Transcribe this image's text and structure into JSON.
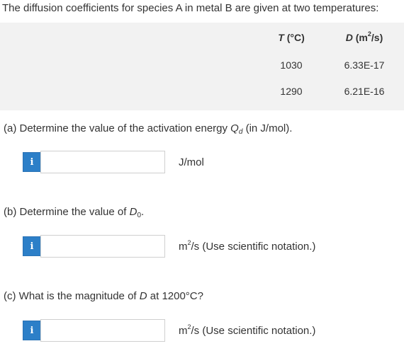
{
  "intro": "The diffusion coefficients for species A in metal B are given at two temperatures:",
  "table": {
    "header_t_italic": "T",
    "header_t_rest": " (°C)",
    "header_d_italic": "D",
    "header_d_unit": " (m",
    "header_d_exp": "2",
    "header_d_close": "/s)",
    "rows": [
      {
        "t": "1030",
        "d": "6.33E-17"
      },
      {
        "t": "1290",
        "d": "6.21E-16"
      }
    ]
  },
  "questions": {
    "a": {
      "prefix": "(a) Determine the value of the activation energy ",
      "sym": "Q",
      "sub": "d",
      "suffix": " (in J/mol)."
    },
    "b": {
      "prefix": "(b) Determine the value of ",
      "sym": "D",
      "sub": "0",
      "suffix": "."
    },
    "c": {
      "prefix": "(c) What is the magnitude of ",
      "sym": "D",
      "suffix": " at 1200°C?"
    }
  },
  "answers": {
    "a": {
      "value": "",
      "unit": "J/mol"
    },
    "b": {
      "value": "",
      "unit_base": "m",
      "unit_exp": "2",
      "unit_rest": "/s (Use scientific notation.)"
    },
    "c": {
      "value": "",
      "unit_base": "m",
      "unit_exp": "2",
      "unit_rest": "/s (Use scientific notation.)"
    }
  },
  "info_icon_glyph": "i",
  "colors": {
    "info_button": "#2c7fc8",
    "table_bg": "#f2f2f2",
    "text": "#333333"
  }
}
